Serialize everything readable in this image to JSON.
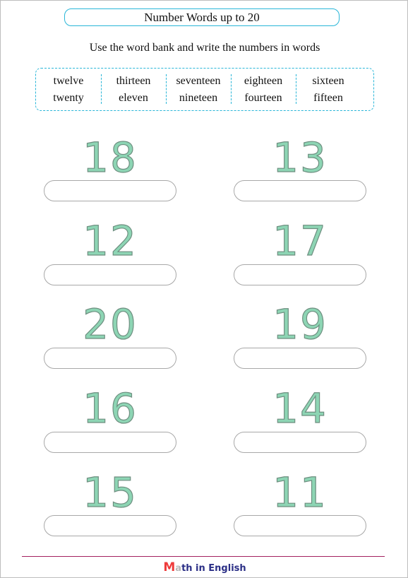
{
  "title": "Number Words up to 20",
  "instruction": "Use the word bank and write the numbers in words",
  "word_bank": {
    "columns": [
      [
        "twelve",
        "twenty"
      ],
      [
        "thirteen",
        "eleven"
      ],
      [
        "seventeen",
        "nineteen"
      ],
      [
        "eighteen",
        "fourteen"
      ],
      [
        "sixteen",
        "fifteen"
      ]
    ]
  },
  "exercises": [
    {
      "number": "18",
      "answer": ""
    },
    {
      "number": "13",
      "answer": ""
    },
    {
      "number": "12",
      "answer": ""
    },
    {
      "number": "17",
      "answer": ""
    },
    {
      "number": "20",
      "answer": ""
    },
    {
      "number": "19",
      "answer": ""
    },
    {
      "number": "16",
      "answer": ""
    },
    {
      "number": "14",
      "answer": ""
    },
    {
      "number": "15",
      "answer": ""
    },
    {
      "number": "11",
      "answer": ""
    }
  ],
  "footer": {
    "brand_first": "M",
    "brand_second": "a",
    "brand_rest": "th in English"
  },
  "colors": {
    "accent": "#29b6d8",
    "number_fill": "#8dd5b4",
    "footer_line": "#a3205f",
    "brand_blue": "#2b2f86",
    "brand_red": "#ee3b3b"
  }
}
